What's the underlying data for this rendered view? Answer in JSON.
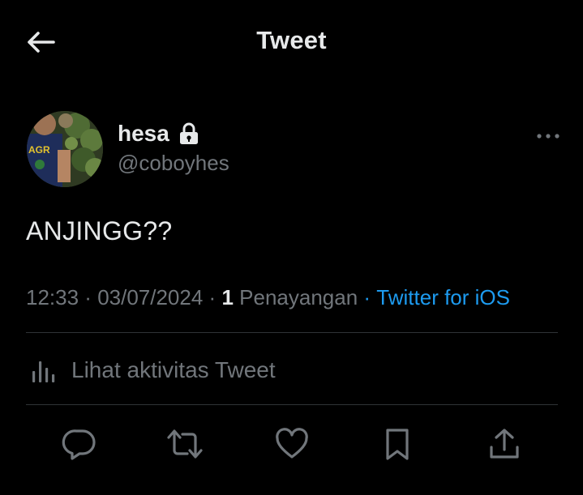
{
  "header": {
    "title": "Tweet",
    "back_icon": "arrow-left-icon"
  },
  "author": {
    "display_name": "hesa",
    "username": "@coboyhes",
    "protected_icon": "lock-icon",
    "avatar_icon": "avatar"
  },
  "tweet": {
    "text": "ANJINGG??",
    "time": "12:33",
    "date": "03/07/2024",
    "view_count": "1",
    "view_label": "Penayangan",
    "source": "Twitter for iOS",
    "more_icon": "more-horizontal-icon"
  },
  "activity": {
    "label": "Lihat aktivitas Tweet",
    "icon": "bar-chart-icon"
  },
  "actions": [
    {
      "name": "reply",
      "icon": "reply-icon"
    },
    {
      "name": "retweet",
      "icon": "retweet-icon"
    },
    {
      "name": "like",
      "icon": "heart-icon"
    },
    {
      "name": "bookmark",
      "icon": "bookmark-icon"
    },
    {
      "name": "share",
      "icon": "share-icon"
    }
  ],
  "colors": {
    "background": "#000000",
    "primary_text": "#e7e9ea",
    "secondary_text": "#71767b",
    "accent": "#1d9bf0",
    "divider": "#2f3336"
  }
}
